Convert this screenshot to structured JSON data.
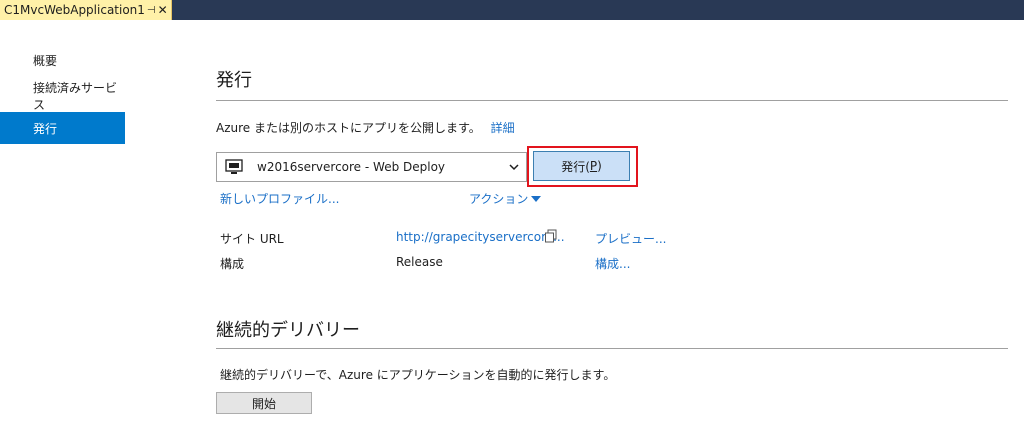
{
  "tab": {
    "title": "C1MvcWebApplication1",
    "pin_glyph": "⊣",
    "close_glyph": "✕"
  },
  "sidebar": {
    "items": [
      {
        "label": "概要",
        "active": false
      },
      {
        "label": "接続済みサービス",
        "active": false
      },
      {
        "label": "発行",
        "active": true
      }
    ]
  },
  "publish": {
    "title": "発行",
    "description": "Azure または別のホストにアプリを公開します。",
    "details_link": "詳細",
    "profile_selected": "w2016servercore - Web Deploy",
    "publish_button_label": "発行(",
    "publish_button_mnemonic": "P",
    "publish_button_suffix": ")",
    "new_profile_link": "新しいプロファイル...",
    "actions_link": "アクション",
    "site_url_label": "サイト URL",
    "site_url_value": "http://grapecityservercore...",
    "preview_link": "プレビュー...",
    "config_label": "構成",
    "config_value": "Release",
    "config_link": "構成..."
  },
  "continuous": {
    "title": "継続的デリバリー",
    "description": "継続的デリバリーで、Azure にアプリケーションを自動的に発行します。",
    "start_button_label": "開始"
  },
  "colors": {
    "accent": "#007acc",
    "highlight_border": "#e2141d",
    "link": "#1a6fc7",
    "tab_active": "#fff1a8"
  }
}
